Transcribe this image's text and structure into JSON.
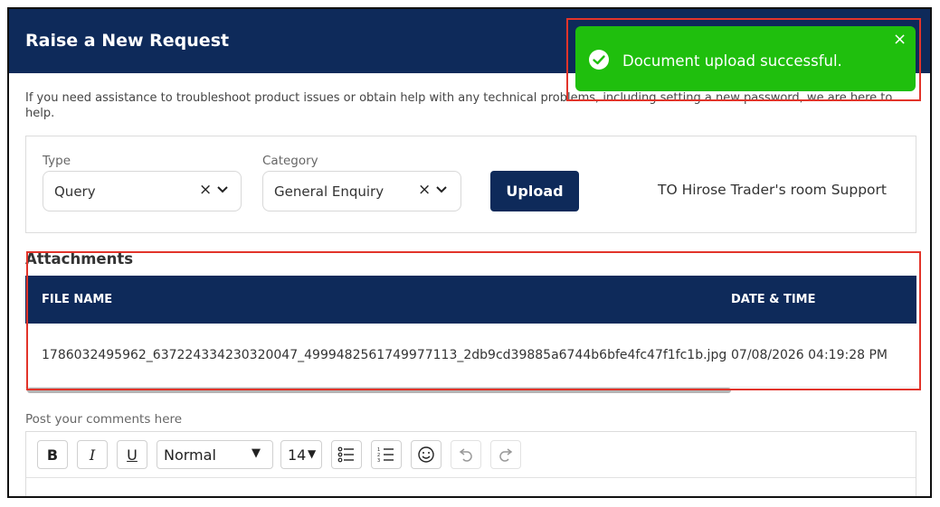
{
  "header": {
    "title": "Raise a New Request"
  },
  "intro_text": "If you need assistance to troubleshoot product issues or obtain help with any technical problems, including setting a new password, we are here to help.",
  "form": {
    "type_label": "Type",
    "type_value": "Query",
    "category_label": "Category",
    "category_value": "General Enquiry",
    "upload_label": "Upload",
    "support_text": "TO Hirose Trader's room Support"
  },
  "attachments": {
    "title": "Attachments",
    "columns": [
      "FILE NAME",
      "DATE & TIME"
    ],
    "rows": [
      {
        "file_name": "1786032495962_637224334230320047_4999482561749977113_2db9cd39885a6744b6bfe4fc47f1fc1b.jpg",
        "date_time": "07/08/2026 04:19:28 PM"
      }
    ]
  },
  "comments": {
    "label": "Post your comments here",
    "toolbar": {
      "bold": "B",
      "italic": "I",
      "underline": "U",
      "style_value": "Normal",
      "size_value": "14"
    }
  },
  "toast": {
    "message": "Document upload successful.",
    "close": "×"
  },
  "colors": {
    "header_bg": "#0e2a5a",
    "toast_bg": "#1fbf0d",
    "highlight": "#e2342a"
  },
  "icons": [
    "check-circle-icon",
    "close-icon",
    "chevron-down-icon",
    "clear-icon",
    "bullet-list-icon",
    "numbered-list-icon",
    "emoji-icon",
    "undo-icon",
    "redo-icon"
  ]
}
